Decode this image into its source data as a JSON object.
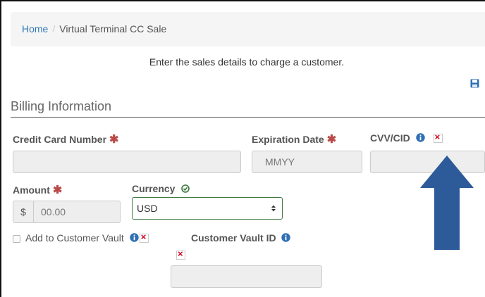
{
  "breadcrumb": {
    "home": "Home",
    "separator": "/",
    "current": "Virtual Terminal CC Sale"
  },
  "instructions": "Enter the sales details to charge a customer.",
  "section": {
    "title": "Billing Information"
  },
  "fields": {
    "card_number": {
      "label": "Credit Card Number",
      "required": "✱",
      "value": ""
    },
    "expiration": {
      "label": "Expiration Date",
      "required": "✱",
      "placeholder": "MMYY"
    },
    "cvv": {
      "label": "CVV/CID",
      "value": ""
    },
    "amount": {
      "label": "Amount",
      "required": "✱",
      "prefix": "$",
      "placeholder": "00.00"
    },
    "currency": {
      "label": "Currency",
      "selected": "USD"
    },
    "vault_checkbox": {
      "label": "Add to Customer Vault",
      "checked": false
    },
    "vault_id": {
      "label": "Customer Vault ID",
      "value": ""
    }
  },
  "colors": {
    "link": "#337ab7",
    "required": "#b94a48",
    "info": "#2f6fb5",
    "success": "#3c763d",
    "arrow": "#2d5b9a"
  },
  "icons": [
    "save-icon",
    "info-icon",
    "broken-image-icon",
    "check-circle-icon",
    "arrow-up-icon"
  ]
}
